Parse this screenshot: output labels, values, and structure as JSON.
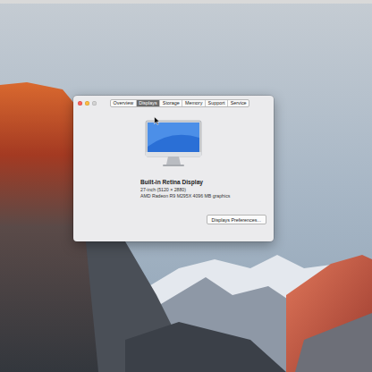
{
  "window_controls": [
    {
      "color": "#fc605c"
    },
    {
      "color": "#fdbc40"
    },
    {
      "color": "#d3d3d3"
    }
  ],
  "tabs": [
    {
      "label": "Overview",
      "selected": false
    },
    {
      "label": "Displays",
      "selected": true
    },
    {
      "label": "Storage",
      "selected": false
    },
    {
      "label": "Memory",
      "selected": false
    },
    {
      "label": "Support",
      "selected": false
    },
    {
      "label": "Service",
      "selected": false
    }
  ],
  "display": {
    "name": "Built-in Retina Display",
    "size": "27-inch (5120 × 2880)",
    "graphics": "AMD Radeon R9 M295X 4096 MB graphics"
  },
  "buttons": [
    "Displays Preferences..."
  ]
}
